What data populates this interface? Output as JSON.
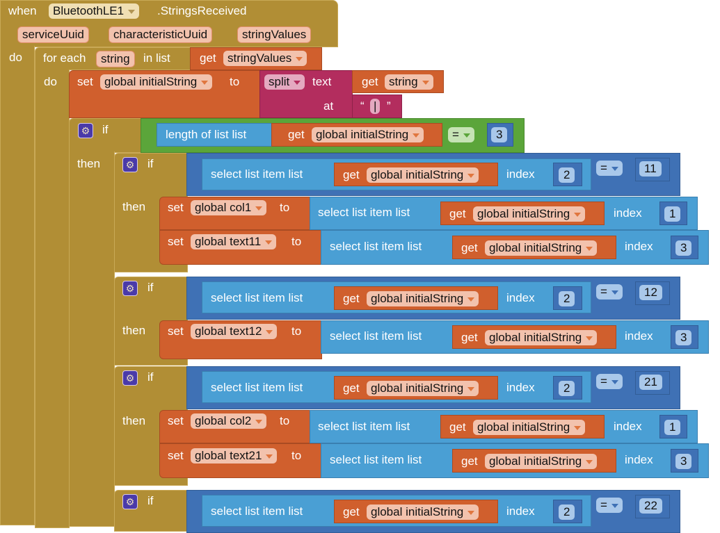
{
  "event": {
    "keyword_when": "when",
    "component": "BluetoothLE1",
    "event_name": ".StringsReceived",
    "params": [
      "serviceUuid",
      "characteristicUuid",
      "stringValues"
    ],
    "keyword_do": "do"
  },
  "foreach": {
    "label_for_each": "for each",
    "var": "string",
    "label_in_list": "in list",
    "get_label": "get",
    "list_var": "stringValues",
    "keyword_do": "do"
  },
  "set_initial": {
    "set_label": "set",
    "var": "global initialString",
    "to_label": "to",
    "split_op": "split",
    "text_label": "text",
    "at_label": "at",
    "get_label": "get",
    "text_var": "string",
    "quote_open": "“",
    "quote_close": "”",
    "separator": "|"
  },
  "outer_if": {
    "if_label": "if",
    "then_label": "then",
    "length_label": "length of list  list",
    "get_label": "get",
    "list_var": "global initialString",
    "op": "=",
    "value": "3"
  },
  "common": {
    "select_label": "select list item  list",
    "get_label": "get",
    "list_var": "global initialString",
    "index_label": "index",
    "if_label": "if",
    "then_label": "then",
    "set_label": "set",
    "to_label": "to",
    "eq_op": "="
  },
  "inner_ifs": [
    {
      "cond_index": "2",
      "compare_value": "11",
      "sets": [
        {
          "var": "global col1",
          "index": "1"
        },
        {
          "var": "global text11",
          "index": "3"
        }
      ]
    },
    {
      "cond_index": "2",
      "compare_value": "12",
      "sets": [
        {
          "var": "global text12",
          "index": "3"
        }
      ]
    },
    {
      "cond_index": "2",
      "compare_value": "21",
      "sets": [
        {
          "var": "global col2",
          "index": "1"
        },
        {
          "var": "global text21",
          "index": "3"
        }
      ]
    },
    {
      "cond_index": "2",
      "compare_value": "22",
      "sets": []
    }
  ]
}
